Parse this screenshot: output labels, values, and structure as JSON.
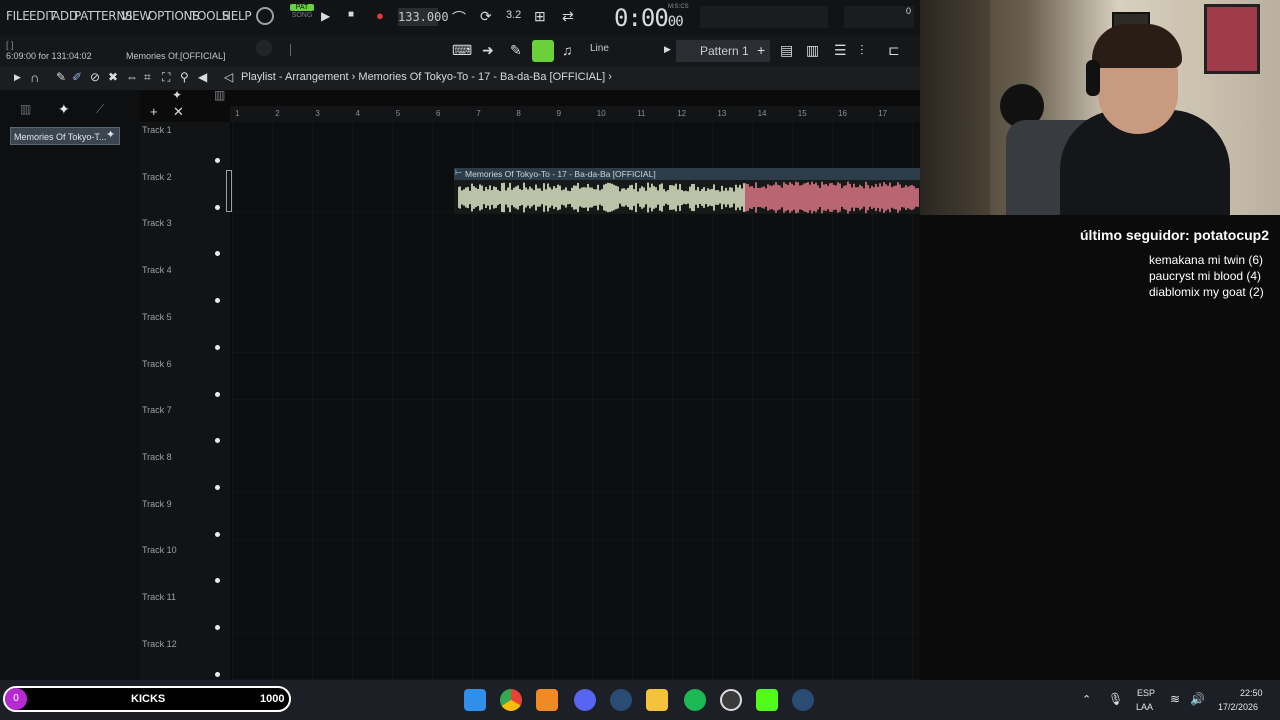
{
  "menu": [
    "FILE",
    "EDIT",
    "ADD",
    "PATTERNS",
    "VIEW",
    "OPTIONS",
    "TOOLS",
    "HELP"
  ],
  "transport": {
    "pat": "PAT",
    "song": "SONG",
    "tempo": "133.000",
    "time_main": "0:00",
    "time_sub": "00",
    "time_label": "M:S:CS",
    "corner_value": "0"
  },
  "hint": {
    "brackets": "[ ]",
    "time": "6:09:00 for 131:04:02",
    "clip": "Memories Of.[OFFICIAL]"
  },
  "toolbar": {
    "snap": "Line",
    "pattern": "Pattern 1"
  },
  "playlist": {
    "title": "Playlist - Arrangement",
    "separator": "›",
    "clip_name": "Memories Of Tokyo-To - 17 - Ba-da-Ba [OFFICIAL]"
  },
  "browser": {
    "clip_chip": "Memories Of Tokyo-T..."
  },
  "ruler": [
    "1",
    "2",
    "3",
    "4",
    "5",
    "6",
    "7",
    "8",
    "9",
    "10",
    "11",
    "12",
    "13",
    "14",
    "15",
    "16",
    "17"
  ],
  "tracks": [
    "Track 1",
    "Track 2",
    "Track 3",
    "Track 4",
    "Track 5",
    "Track 6",
    "Track 7",
    "Track 8",
    "Track 9",
    "Track 10",
    "Track 11",
    "Track 12"
  ],
  "clip": {
    "header": "Memories Of Tokyo-To - 17 - Ba-da-Ba [OFFICIAL]"
  },
  "overlay": {
    "follower": "último seguidor: potatocup2",
    "shoutouts": [
      "kemakana mi twin (6)",
      "paucryst mi blood (4)",
      "diablomix my goat (2)"
    ]
  },
  "kicks": {
    "count": "0",
    "label": "KICKS",
    "value": "1000"
  },
  "tray": {
    "lang": "ESP",
    "layout": "LAA",
    "time": "22:50",
    "date": "17/2/2026"
  },
  "colors": {
    "accent_green": "#6bd13a",
    "wave_light": "#e6eccd",
    "wave_pink": "#e47a8a",
    "kicks_purple": "#b52bd1"
  }
}
